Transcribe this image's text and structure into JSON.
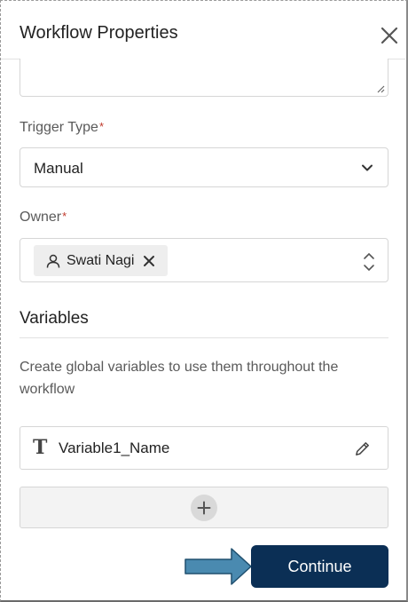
{
  "dialog": {
    "title": "Workflow Properties"
  },
  "trigger_type": {
    "label": "Trigger Type",
    "required_mark": "*",
    "value": "Manual"
  },
  "owner": {
    "label": "Owner",
    "required_mark": "*",
    "chips": [
      {
        "name": "Swati Nagi"
      }
    ]
  },
  "variables": {
    "heading": "Variables",
    "description": "Create global variables to use them throughout the workflow",
    "items": [
      {
        "type_icon": "T",
        "name": "Variable1_Name"
      }
    ]
  },
  "footer": {
    "continue_label": "Continue"
  },
  "colors": {
    "primary_button": "#0b2f55",
    "arrow_fill": "#4a8ab0",
    "required": "#c0392b"
  },
  "icons": [
    "close-icon",
    "resize-grip-icon",
    "chevron-down-icon",
    "user-icon",
    "remove-chip-icon",
    "sort-updown-icon",
    "text-type-icon",
    "pencil-icon",
    "plus-icon",
    "arrow-right-icon"
  ]
}
